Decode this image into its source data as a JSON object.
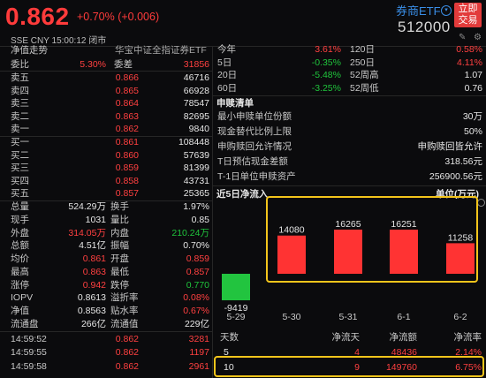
{
  "header": {
    "price": "0.862",
    "change": "+0.70% (+0.006)",
    "market": "SSE",
    "currency": "CNY",
    "time": "15:00:12",
    "status": "闭市",
    "etf_name": "券商ETF",
    "code": "512000",
    "buy_button": "立即交易",
    "buy_button_line1": "立即",
    "buy_button_line2": "交易",
    "icons": [
      "edit-icon",
      "settings-icon"
    ]
  },
  "fund": {
    "label": "净值走势",
    "name": "华宝中证全指证券ETF"
  },
  "order_ratio": {
    "label1": "委比",
    "value1": "5.30%",
    "label2": "委差",
    "value2": "31856"
  },
  "asks": [
    {
      "label": "卖五",
      "price": "0.866",
      "vol": "46716"
    },
    {
      "label": "卖四",
      "price": "0.865",
      "vol": "66928"
    },
    {
      "label": "卖三",
      "price": "0.864",
      "vol": "78547"
    },
    {
      "label": "卖二",
      "price": "0.863",
      "vol": "82695"
    },
    {
      "label": "卖一",
      "price": "0.862",
      "vol": "9840"
    }
  ],
  "bids": [
    {
      "label": "买一",
      "price": "0.861",
      "vol": "108448"
    },
    {
      "label": "买二",
      "price": "0.860",
      "vol": "57639"
    },
    {
      "label": "买三",
      "price": "0.859",
      "vol": "81399"
    },
    {
      "label": "买四",
      "price": "0.858",
      "vol": "43731"
    },
    {
      "label": "买五",
      "price": "0.857",
      "vol": "25365"
    }
  ],
  "stats": [
    {
      "l1": "总量",
      "v1": "524.29万",
      "c1": "white",
      "l2": "换手",
      "v2": "1.97%",
      "c2": "white"
    },
    {
      "l1": "现手",
      "v1": "1031",
      "c1": "white",
      "l2": "量比",
      "v2": "0.85",
      "c2": "white"
    },
    {
      "l1": "外盘",
      "v1": "314.05万",
      "c1": "red",
      "l2": "内盘",
      "v2": "210.24万",
      "c2": "green"
    },
    {
      "l1": "总额",
      "v1": "4.51亿",
      "c1": "white",
      "l2": "振幅",
      "v2": "0.70%",
      "c2": "white"
    },
    {
      "l1": "均价",
      "v1": "0.861",
      "c1": "red",
      "l2": "开盘",
      "v2": "0.859",
      "c2": "red"
    },
    {
      "l1": "最高",
      "v1": "0.863",
      "c1": "red",
      "l2": "最低",
      "v2": "0.857",
      "c2": "red"
    },
    {
      "l1": "涨停",
      "v1": "0.942",
      "c1": "red",
      "l2": "跌停",
      "v2": "0.770",
      "c2": "green"
    },
    {
      "l1": "IOPV",
      "v1": "0.8613",
      "c1": "white",
      "l2": "溢折率",
      "v2": "0.08%",
      "c2": "red"
    },
    {
      "l1": "净值",
      "v1": "0.8563",
      "c1": "white",
      "l2": "贴水率",
      "v2": "0.67%",
      "c2": "red"
    },
    {
      "l1": "流通盘",
      "v1": "266亿",
      "c1": "white",
      "l2": "流通值",
      "v2": "229亿",
      "c2": "white"
    }
  ],
  "ticks": [
    {
      "time": "14:59:52",
      "price": "0.862",
      "vol": "3281"
    },
    {
      "time": "14:59:55",
      "price": "0.862",
      "vol": "1197"
    },
    {
      "time": "14:59:58",
      "price": "0.862",
      "vol": "2961"
    }
  ],
  "periods": [
    {
      "l1": "今年",
      "v1": "3.61%",
      "c1": "red",
      "l2": "120日",
      "v2": "0.58%",
      "c2": "red"
    },
    {
      "l1": "5日",
      "v1": "-0.35%",
      "c1": "green",
      "l2": "250日",
      "v2": "4.11%",
      "c2": "red"
    },
    {
      "l1": "20日",
      "v1": "-5.48%",
      "c1": "green",
      "l2": "52周高",
      "v2": "1.07",
      "c2": "white"
    },
    {
      "l1": "60日",
      "v1": "-3.25%",
      "c1": "green",
      "l2": "52周低",
      "v2": "0.76",
      "c2": "white"
    }
  ],
  "subscription": {
    "title": "申赎清单",
    "rows": [
      {
        "label": "最小申赎单位份额",
        "value": "30万"
      },
      {
        "label": "现金替代比例上限",
        "value": "50%"
      },
      {
        "label": "申购赎回允许情况",
        "value": "申购赎回皆允许"
      },
      {
        "label": "T日预估现金差额",
        "value": "318.56元"
      },
      {
        "label": "T-1日单位申赎资产",
        "value": "256900.56元"
      }
    ]
  },
  "inflow": {
    "title": "近5日净流入",
    "unit": "单位(万元)",
    "table_headers": [
      "天数",
      "净流天",
      "净流额",
      "净流率"
    ],
    "table_rows": [
      {
        "days": "5",
        "net_days": "4",
        "amount": "48436",
        "rate": "2.14%"
      },
      {
        "days": "10",
        "net_days": "9",
        "amount": "149760",
        "rate": "6.75%"
      }
    ]
  },
  "chart_data": {
    "type": "bar",
    "title": "近5日净流入",
    "ylabel": "单位(万元)",
    "categories": [
      "5-29",
      "5-30",
      "5-31",
      "6-1",
      "6-2"
    ],
    "values": [
      -9419,
      14080,
      16265,
      16251,
      11258
    ],
    "labels": [
      "-9419",
      "14080",
      "16265",
      "16251",
      "11258"
    ],
    "colors": {
      "positive": "#ff3333",
      "negative": "#22c43f"
    }
  },
  "colors": {
    "up": "#ff4040",
    "down": "#1fc43c",
    "highlight": "#f3c51b",
    "accent": "#3a8ee6"
  }
}
